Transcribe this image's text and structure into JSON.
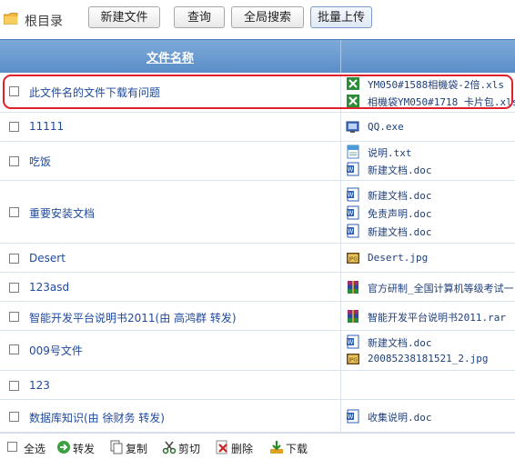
{
  "toolbar": {
    "root_label": "根目录",
    "buttons": [
      "新建文件",
      "查询",
      "全局搜索",
      "批量上传"
    ]
  },
  "header": {
    "title": "文件名称"
  },
  "rows": [
    {
      "name": "此文件名的文件下载有问题",
      "files": [
        {
          "icon": "excel-icon",
          "name": "YM050#1588相機袋-2倍.xls"
        },
        {
          "icon": "excel-icon",
          "name": "相機袋YM050#1718 卡片包.xls"
        }
      ]
    },
    {
      "name": "11111",
      "files": [
        {
          "icon": "exe-icon",
          "name": "QQ.exe"
        }
      ]
    },
    {
      "name": "吃饭",
      "files": [
        {
          "icon": "txt-icon",
          "name": "说明.txt"
        },
        {
          "icon": "word-icon",
          "name": "新建文档.doc"
        }
      ]
    },
    {
      "name": "重要安装文档",
      "files": [
        {
          "icon": "word-icon",
          "name": "新建文档.doc"
        },
        {
          "icon": "word-icon",
          "name": "免责声明.doc"
        },
        {
          "icon": "word-icon",
          "name": "新建文档.doc"
        }
      ]
    },
    {
      "name": "Desert",
      "files": [
        {
          "icon": "jpg-icon",
          "name": "Desert.jpg"
        }
      ]
    },
    {
      "name": "123asd",
      "files": [
        {
          "icon": "rar-icon",
          "name": "官方研制_全国计算机等级考试一"
        }
      ]
    },
    {
      "name": "智能开发平台说明书2011(由 高鸿群 转发)",
      "files": [
        {
          "icon": "rar-icon",
          "name": "智能开发平台说明书2011.rar"
        }
      ]
    },
    {
      "name": "009号文件",
      "files": [
        {
          "icon": "word-icon",
          "name": "新建文档.doc"
        },
        {
          "icon": "jpg-icon",
          "name": "20085238181521_2.jpg"
        }
      ]
    },
    {
      "name": "123",
      "files": []
    },
    {
      "name": "数据库知识(由 徐财务 转发)",
      "files": [
        {
          "icon": "word-icon",
          "name": "收集说明.doc"
        }
      ]
    }
  ],
  "footer": {
    "select_all": "全选",
    "forward": "转发",
    "copy": "复制",
    "cut": "剪切",
    "delete": "删除",
    "download": "下载"
  }
}
